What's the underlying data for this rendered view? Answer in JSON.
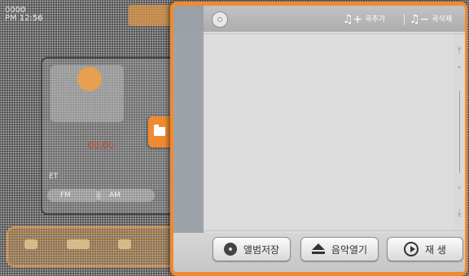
{
  "background": {
    "clock": {
      "line1": "0000",
      "line2": "PM 12:56"
    },
    "red_text": "00:00",
    "et_label": "ET",
    "pill_labels": [
      "FM",
      "AM"
    ]
  },
  "header": {
    "add_song_label": "곡추가",
    "delete_song_label": "곡삭제"
  },
  "footer": {
    "save_album_label": "앨범저장",
    "open_music_label": "음악열기",
    "play_label": "재 생"
  },
  "colors": {
    "accent": "#f08a30",
    "panel": "#d9d9d9"
  },
  "icons": [
    "cd-icon",
    "add-song-icon",
    "delete-song-icon",
    "folder-icon",
    "scroll-top-icon",
    "scroll-up-icon",
    "scroll-down-icon",
    "scroll-bottom-icon",
    "album-save-icon",
    "eject-icon",
    "play-icon"
  ]
}
